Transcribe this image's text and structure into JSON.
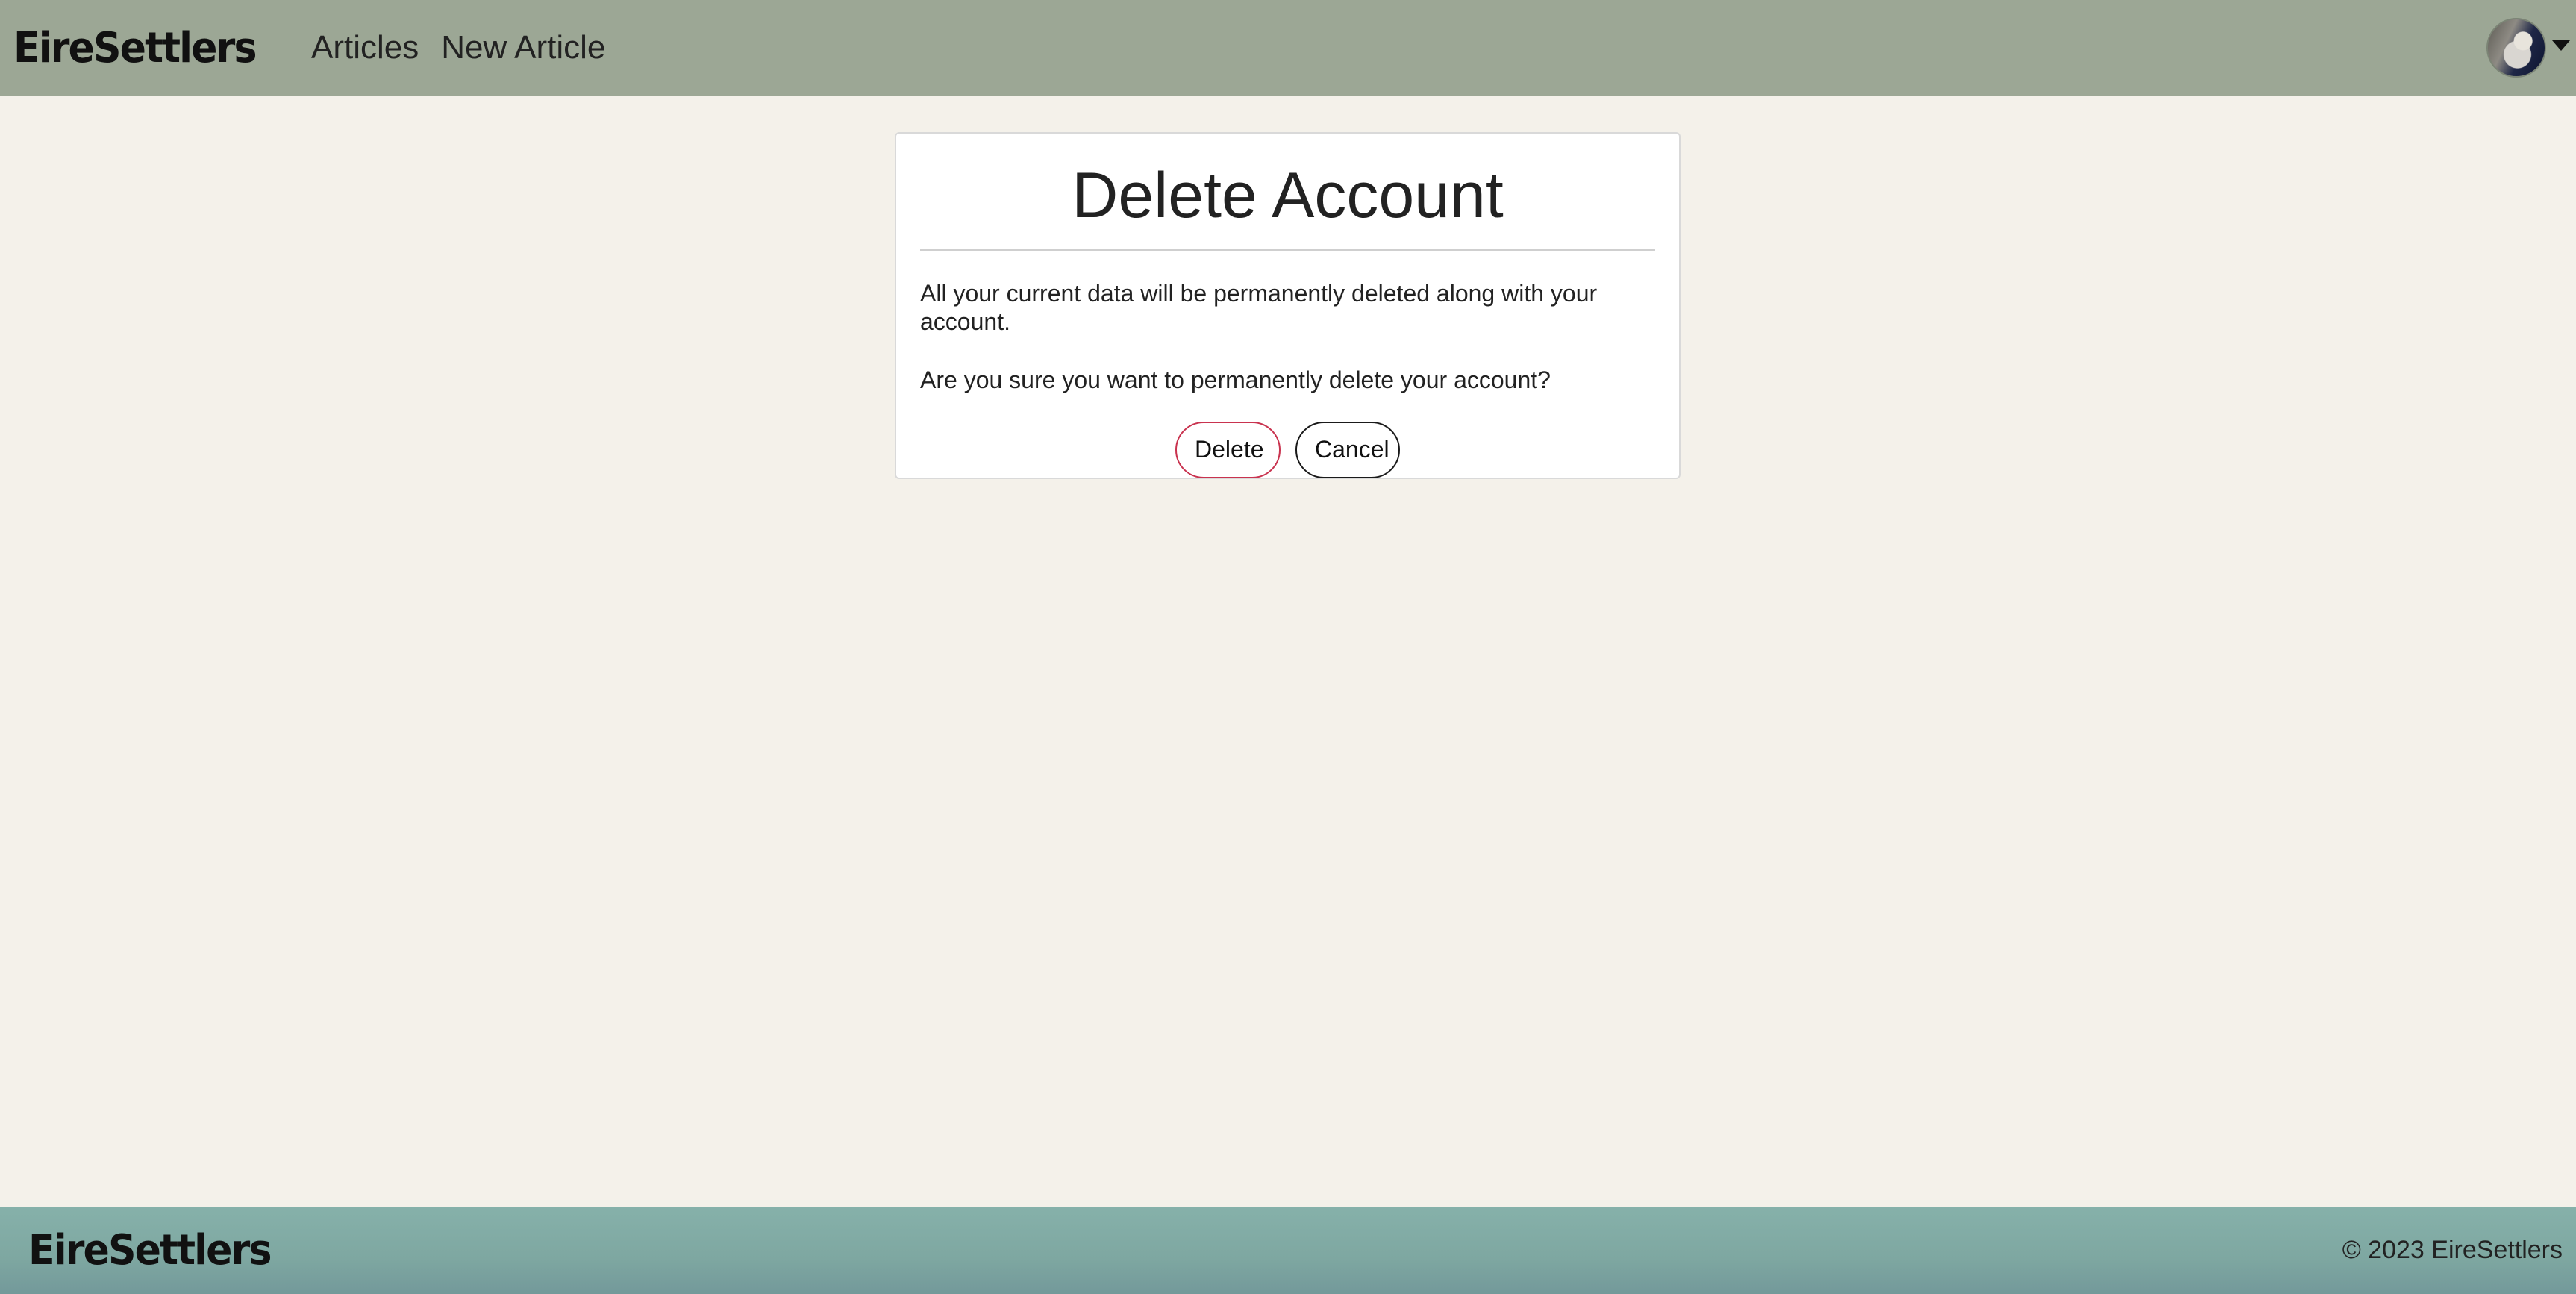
{
  "navbar": {
    "brand": "EireSettlers",
    "links": [
      {
        "label": "Articles"
      },
      {
        "label": "New Article"
      }
    ]
  },
  "card": {
    "title": "Delete Account",
    "message": "All your current data will be permanently deleted along with your account.",
    "question": "Are you sure you want to permanently delete your account?",
    "delete_label": "Delete",
    "cancel_label": "Cancel"
  },
  "footer": {
    "brand": "EireSettlers",
    "copyright": "© 2023 EireSettlers"
  },
  "colors": {
    "navbar_bg": "#9ca795",
    "page_bg": "#f4f1ea",
    "footer_bg": "#86b1aa",
    "delete_border": "#c9334f"
  },
  "icons": {
    "user_menu_caret": "caret-down-icon",
    "avatar": "user-avatar"
  }
}
